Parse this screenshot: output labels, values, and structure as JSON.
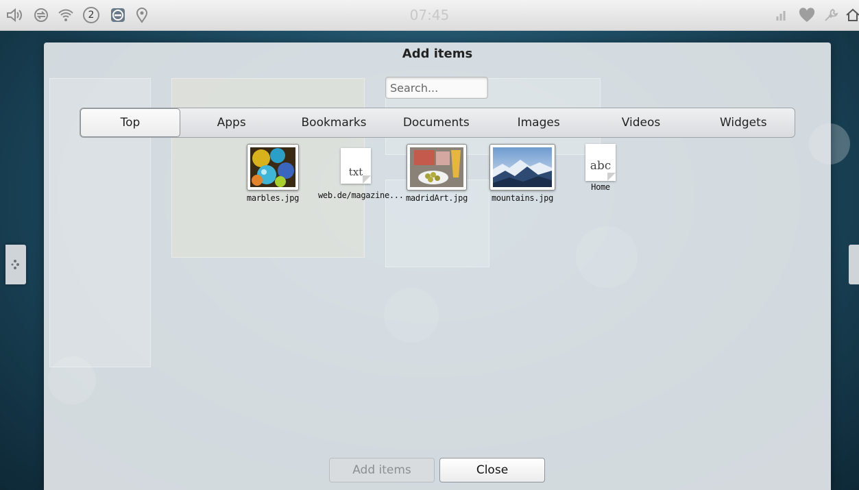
{
  "statusbar": {
    "time": "07:45",
    "notification_count": "2",
    "left_icons": [
      "volume-icon",
      "sync-icon",
      "wifi-icon",
      "notification-count-badge",
      "no-entry-icon",
      "location-pin-icon"
    ],
    "right_icons": [
      "signal-icon",
      "heart-icon",
      "wrench-icon",
      "home-icon"
    ]
  },
  "dialog": {
    "title": "Add items",
    "search": {
      "placeholder": "Search...",
      "value": ""
    },
    "tabs": [
      {
        "label": "Top",
        "active": true
      },
      {
        "label": "Apps",
        "active": false
      },
      {
        "label": "Bookmarks",
        "active": false
      },
      {
        "label": "Documents",
        "active": false
      },
      {
        "label": "Images",
        "active": false
      },
      {
        "label": "Videos",
        "active": false
      },
      {
        "label": "Widgets",
        "active": false
      }
    ],
    "items": [
      {
        "label": "marbles.jpg",
        "kind": "image"
      },
      {
        "label": "web.de/magazine...",
        "kind": "document",
        "glyph": "txt"
      },
      {
        "label": "madridArt.jpg",
        "kind": "image"
      },
      {
        "label": "mountains.jpg",
        "kind": "image"
      },
      {
        "label": "Home",
        "kind": "document",
        "glyph": "abc"
      }
    ],
    "buttons": {
      "add": "Add items",
      "close": "Close"
    }
  },
  "colors": {
    "dialog_bg": "#e2e6e9",
    "desktop_bg": "#1f4f66",
    "disabled_text": "#8c8f91"
  }
}
